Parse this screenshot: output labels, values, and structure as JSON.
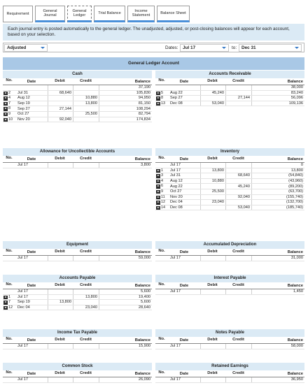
{
  "tabs": [
    {
      "label": "Requirement",
      "state": "normal"
    },
    {
      "label": "General\nJournal",
      "state": "active"
    },
    {
      "label": "General\nLedger",
      "state": "selected"
    },
    {
      "label": "Trial Balance",
      "state": "active"
    },
    {
      "label": "Income\nStatement",
      "state": "active"
    },
    {
      "label": "Balance Sheet",
      "state": "active"
    }
  ],
  "info": "Each journal entry is posted automatically to the general ledger. The unadjusted, adjusted, or post-closing balances will appear for each account, based on your selection.",
  "filter": {
    "view": "Adjusted",
    "dates_label": "Dates:",
    "from": "Jul 17",
    "to_label": "to:",
    "to": "Dec 31"
  },
  "ledger_title": "General Ledger Account",
  "headers": {
    "no": "No.",
    "date": "Date",
    "debit": "Debit",
    "credit": "Credit",
    "balance": "Balance"
  },
  "accounts": [
    {
      "name": "Cash",
      "rows": [
        {
          "no": "",
          "date": "",
          "debit": "",
          "credit": "",
          "balance": "37,190"
        },
        {
          "no": "2",
          "date": "Jul 31",
          "debit": "68,640",
          "credit": "",
          "balance": "105,830"
        },
        {
          "no": "4",
          "date": "Aug 12",
          "debit": "",
          "credit": "10,880",
          "balance": "94,950"
        },
        {
          "no": "7",
          "date": "Sep 19",
          "debit": "",
          "credit": "13,800",
          "balance": "81,150"
        },
        {
          "no": "8",
          "date": "Sep 27",
          "debit": "27,144",
          "credit": "",
          "balance": "108,294"
        },
        {
          "no": "9",
          "date": "Oct 27",
          "debit": "",
          "credit": "25,500",
          "balance": "82,794"
        },
        {
          "no": "10",
          "date": "Nov 20",
          "debit": "92,040",
          "credit": "",
          "balance": "174,834"
        }
      ]
    },
    {
      "name": "Accounts Receivable",
      "rows": [
        {
          "no": "",
          "date": "",
          "debit": "",
          "credit": "",
          "balance": "38,000"
        },
        {
          "no": "5",
          "date": "Aug 22",
          "debit": "45,240",
          "credit": "",
          "balance": "83,240"
        },
        {
          "no": "8",
          "date": "Sep 27",
          "debit": "",
          "credit": "27,144",
          "balance": "56,096"
        },
        {
          "no": "13",
          "date": "Dec 08",
          "debit": "53,040",
          "credit": "",
          "balance": "109,136"
        }
      ]
    },
    {
      "name": "Allowance for Uncollectible Accounts",
      "rows": [
        {
          "no": "",
          "date": "Jul 17",
          "debit": "",
          "credit": "",
          "balance": "3,800"
        }
      ]
    },
    {
      "name": "Inventory",
      "rows": [
        {
          "no": "",
          "date": "Jul 17",
          "debit": "",
          "credit": "",
          "balance": "0"
        },
        {
          "no": "1",
          "date": "Jul 17",
          "debit": "13,800",
          "credit": "",
          "balance": "13,800"
        },
        {
          "no": "3",
          "date": "Jul 31",
          "debit": "",
          "credit": "68,640",
          "balance": "(54,840)"
        },
        {
          "no": "4",
          "date": "Aug 12",
          "debit": "10,880",
          "credit": "",
          "balance": "(43,960)"
        },
        {
          "no": "6",
          "date": "Aug 22",
          "debit": "",
          "credit": "45,240",
          "balance": "(89,200)"
        },
        {
          "no": "9",
          "date": "Oct 27",
          "debit": "25,500",
          "credit": "",
          "balance": "(63,700)"
        },
        {
          "no": "11",
          "date": "Nov 20",
          "debit": "",
          "credit": "92,040",
          "balance": "(155,740)"
        },
        {
          "no": "12",
          "date": "Dec 04",
          "debit": "23,040",
          "credit": "",
          "balance": "(132,700)"
        },
        {
          "no": "14",
          "date": "Dec 08",
          "debit": "",
          "credit": "53,040",
          "balance": "(185,740)"
        }
      ]
    },
    {
      "name": "Equipment",
      "rows": [
        {
          "no": "",
          "date": "Jul 17",
          "debit": "",
          "credit": "",
          "balance": "59,000"
        }
      ]
    },
    {
      "name": "Accumulated Depreciation",
      "rows": [
        {
          "no": "",
          "date": "Jul 17",
          "debit": "",
          "credit": "",
          "balance": "31,000"
        }
      ]
    },
    {
      "name": "Accounts Payable",
      "rows": [
        {
          "no": "",
          "date": "Jul 17",
          "debit": "",
          "credit": "",
          "balance": "5,600"
        },
        {
          "no": "1",
          "date": "Jul 17",
          "debit": "",
          "credit": "13,800",
          "balance": "19,400"
        },
        {
          "no": "7",
          "date": "Sep 19",
          "debit": "13,800",
          "credit": "",
          "balance": "5,600"
        },
        {
          "no": "12",
          "date": "Dec 04",
          "debit": "",
          "credit": "23,040",
          "balance": "28,640"
        }
      ]
    },
    {
      "name": "Interest Payable",
      "rows": [
        {
          "no": "",
          "date": "Jul 17",
          "debit": "",
          "credit": "",
          "balance": "1,450"
        }
      ]
    },
    {
      "name": "Income Tax Payable",
      "rows": [
        {
          "no": "",
          "date": "Jul 17",
          "debit": "",
          "credit": "",
          "balance": "15,900"
        }
      ]
    },
    {
      "name": "Notes Payable",
      "rows": [
        {
          "no": "",
          "date": "Jul 17",
          "debit": "",
          "credit": "",
          "balance": "58,000"
        }
      ]
    },
    {
      "name": "Common Stock",
      "rows": [
        {
          "no": "",
          "date": "Jul 17",
          "debit": "",
          "credit": "",
          "balance": "26,090"
        }
      ]
    },
    {
      "name": "Retained Earnings",
      "rows": [
        {
          "no": "",
          "date": "Jul 17",
          "debit": "",
          "credit": "",
          "balance": "36,950"
        }
      ]
    }
  ],
  "colors": {
    "info_bg": "#dbeaf5",
    "header_bar": "#a9c8e6",
    "tab_accent": "#4a90d9"
  }
}
